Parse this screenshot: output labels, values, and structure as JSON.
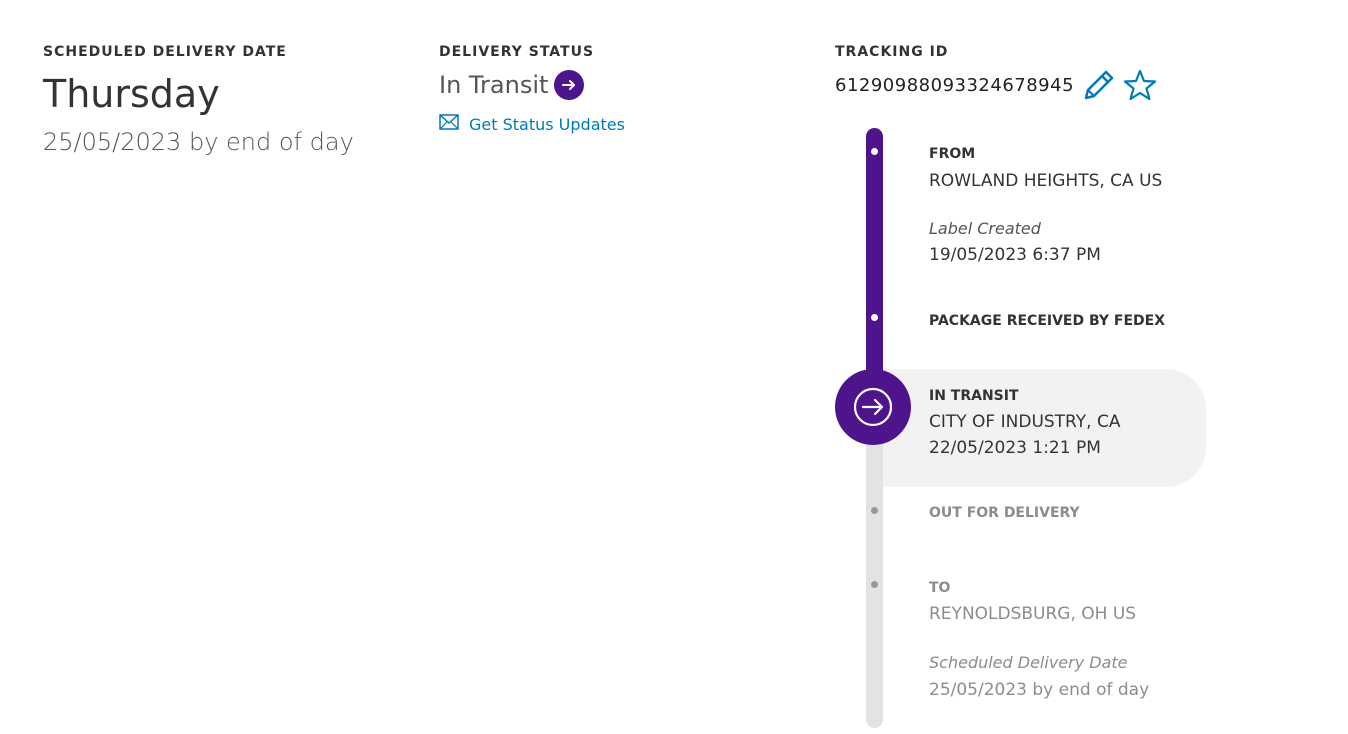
{
  "scheduled": {
    "label": "SCHEDULED DELIVERY DATE",
    "day": "Thursday",
    "date": "25/05/2023 by end of day"
  },
  "status": {
    "label": "DELIVERY STATUS",
    "value": "In Transit",
    "updates_link": "Get Status Updates",
    "icons": [
      "arrow-right-circle-icon",
      "envelope-icon"
    ]
  },
  "tracking": {
    "label": "TRACKING ID",
    "id": "612909880933246789 45",
    "icons": [
      "pencil-icon",
      "star-icon"
    ]
  },
  "timeline": {
    "from": {
      "head": "FROM",
      "location": "ROWLAND HEIGHTS, CA US",
      "event": "Label Created",
      "datetime": "19/05/2023 6:37 PM"
    },
    "received": {
      "head": "PACKAGE RECEIVED BY FEDEX"
    },
    "current": {
      "head": "IN TRANSIT",
      "location": "CITY OF INDUSTRY, CA",
      "datetime": "22/05/2023 1:21 PM"
    },
    "out_for_delivery": {
      "head": "OUT FOR DELIVERY"
    },
    "to": {
      "head": "TO",
      "location": "REYNOLDSBURG, OH US",
      "event": "Scheduled Delivery Date",
      "datetime": "25/05/2023 by end of day"
    }
  },
  "colors": {
    "brand_purple": "#4d148c",
    "link_blue": "#007ab7",
    "pending_grey": "#e3e3e3"
  }
}
